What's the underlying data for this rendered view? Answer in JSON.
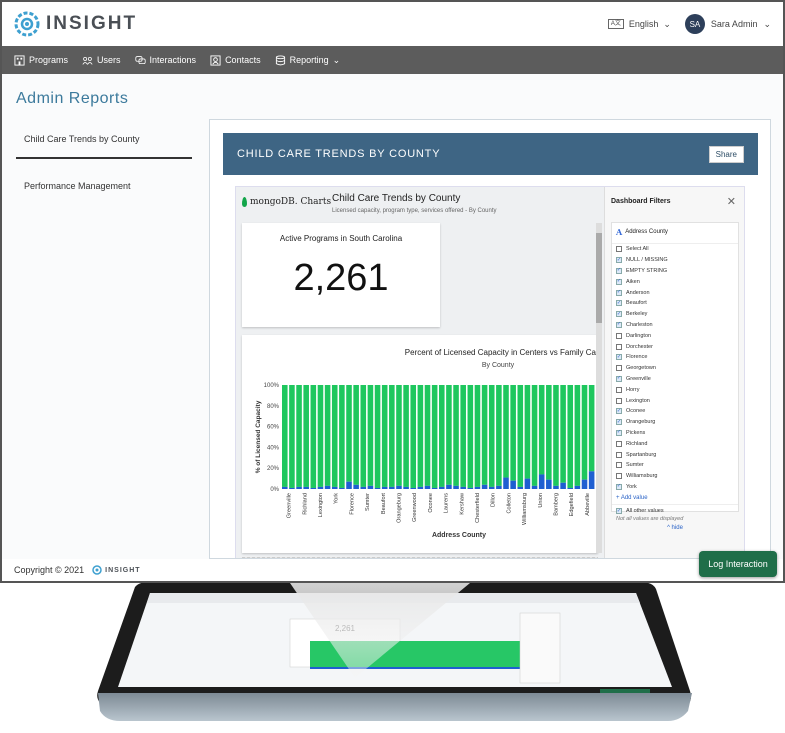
{
  "brand": {
    "name": "INSIGHT",
    "accent": "#3ea0d0"
  },
  "topbar": {
    "language_badge": "A文",
    "language": "English",
    "user_initials": "SA",
    "user_name": "Sara Admin"
  },
  "nav": {
    "programs": "Programs",
    "users": "Users",
    "interactions": "Interactions",
    "contacts": "Contacts",
    "reporting": "Reporting"
  },
  "page": {
    "title": "Admin Reports"
  },
  "sidebar": {
    "items": [
      {
        "label": "Child Care Trends by County"
      },
      {
        "label": "Performance Management"
      }
    ]
  },
  "panel": {
    "title": "CHILD CARE TRENDS BY COUNTY",
    "share_label": "Share"
  },
  "embed": {
    "logo_text": "mongoDB. Charts",
    "title": "Child Care Trends by County",
    "subtitle": "Licensed capacity, program type, services offered - By County",
    "kpi_title": "Active Programs in South Carolina",
    "kpi_value": "2,261"
  },
  "filters": {
    "title": "Dashboard Filters",
    "field": "Address County",
    "select_all": "Select All",
    "options": [
      {
        "label": "NULL / MISSING",
        "checked": true
      },
      {
        "label": "EMPTY STRING",
        "checked": true
      },
      {
        "label": "Aiken",
        "checked": true
      },
      {
        "label": "Anderson",
        "checked": true
      },
      {
        "label": "Beaufort",
        "checked": true
      },
      {
        "label": "Berkeley",
        "checked": true
      },
      {
        "label": "Charleston",
        "checked": true
      },
      {
        "label": "Darlington",
        "checked": false
      },
      {
        "label": "Dorchester",
        "checked": false
      },
      {
        "label": "Florence",
        "checked": true
      },
      {
        "label": "Georgetown",
        "checked": false
      },
      {
        "label": "Greenville",
        "checked": true
      },
      {
        "label": "Horry",
        "checked": false
      },
      {
        "label": "Lexington",
        "checked": false
      },
      {
        "label": "Oconee",
        "checked": true
      },
      {
        "label": "Orangeburg",
        "checked": true
      },
      {
        "label": "Pickens",
        "checked": true
      },
      {
        "label": "Richland",
        "checked": false
      },
      {
        "label": "Spartanburg",
        "checked": false
      },
      {
        "label": "Sumter",
        "checked": false
      },
      {
        "label": "Williamsburg",
        "checked": false
      },
      {
        "label": "York",
        "checked": true
      }
    ],
    "add_value": "+ Add value",
    "other_values": "All other values",
    "note": "Not all values are displayed",
    "hide": "^ hide"
  },
  "chart_data": {
    "type": "bar",
    "title": "Percent of Licensed Capacity in Centers vs Family Ca",
    "subtitle": "By County",
    "xlabel": "Address County",
    "ylabel": "% of Licensed Capacity",
    "ylim": [
      0,
      100
    ],
    "yticks": [
      "0%",
      "20%",
      "40%",
      "60%",
      "80%",
      "100%"
    ],
    "categories": [
      "Greenville",
      "Richland",
      "Lexington",
      "York",
      "Florence",
      "Sumter",
      "Beaufort",
      "Orangeburg",
      "Greenwood",
      "Oconee",
      "Laurens",
      "Kershaw",
      "Chesterfield",
      "Dillon",
      "Colleton",
      "Williamsburg",
      "Union",
      "Bamberg",
      "Edgefield",
      "Abbeville"
    ],
    "stacked": true,
    "series": [
      {
        "name": "",
        "color": "#1f5fd1",
        "values": [
          2,
          2,
          3,
          2,
          7,
          3,
          2,
          2,
          3,
          2,
          3,
          1,
          2,
          4,
          3,
          11,
          8,
          5,
          2,
          17
        ]
      },
      {
        "name": "",
        "color": "#1ec75e",
        "values": [
          98,
          98,
          97,
          98,
          93,
          97,
          98,
          98,
          97,
          98,
          97,
          99,
          98,
          96,
          97,
          89,
          92,
          95,
          98,
          83
        ]
      }
    ],
    "bar_count": 44,
    "blue_pattern": [
      2,
      1,
      2,
      2,
      1,
      2,
      3,
      2,
      1,
      7,
      4,
      2,
      3,
      1,
      2,
      2,
      3,
      2,
      1,
      2,
      3,
      1,
      2,
      4,
      3,
      2,
      1,
      2,
      4,
      2,
      3,
      11,
      8,
      2,
      10,
      3,
      14,
      9,
      3,
      6,
      1,
      3,
      9,
      17
    ]
  },
  "footer": {
    "copyright": "Copyright © 2021",
    "brand": "INSIGHT"
  },
  "actions": {
    "log_interaction": "Log Interaction"
  }
}
